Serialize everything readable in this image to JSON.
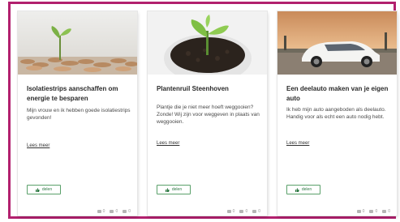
{
  "accent_color": "#b2206e",
  "button_color": "#2f7a45",
  "cards": [
    {
      "image": "coin-stacks-with-plant-photo",
      "title": "Isolatiestrips aanschaffen om energie te besparen",
      "text": "Mijn vrouw en ik hebben goede isolatiestrips gevonden!",
      "link": "Lees meer",
      "share_label": "delen",
      "stats": [
        "0",
        "0",
        "0"
      ]
    },
    {
      "image": "seedling-in-soil-pot-photo",
      "title": "Plantenruil Steenhoven",
      "text": "Plantje die je niet meer hoeft weggooien? Zonde! Wij zijn voor weggeven in plaats van weggooien.",
      "link": "Lees meer",
      "share_label": "delen",
      "stats": [
        "0",
        "0",
        "0"
      ]
    },
    {
      "image": "white-car-on-road-photo",
      "title": "Een deelauto maken van je eigen auto",
      "text": "Ik heb mijn auto aangeboden als deelauto. Handig voor als echt een auto nodig hebt.",
      "link": "Lees meer",
      "share_label": "delen",
      "stats": [
        "0",
        "0",
        "0"
      ]
    }
  ]
}
